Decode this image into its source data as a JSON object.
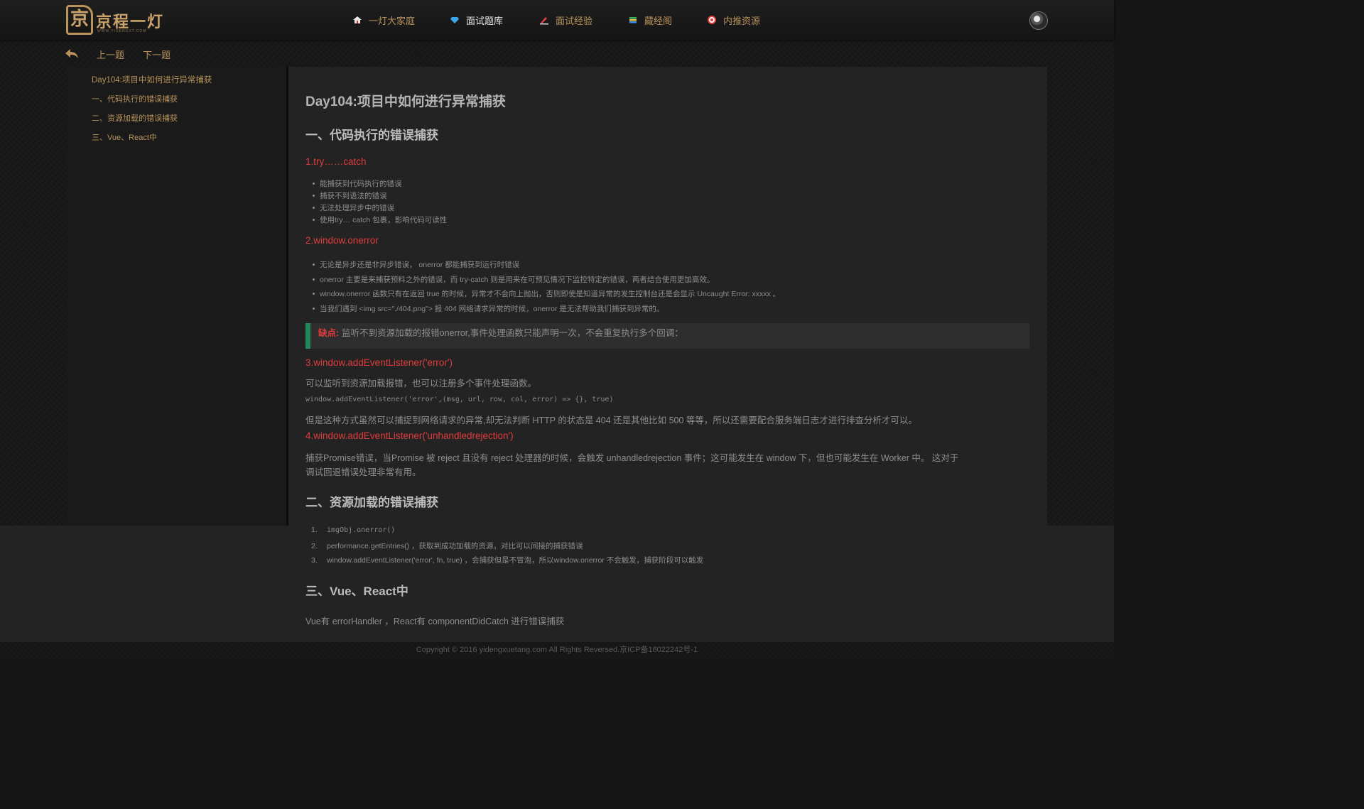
{
  "header": {
    "logo_text": "京程一灯",
    "logo_sub": "WWW.YIDENGXT.COM",
    "nav": [
      {
        "label": "一灯大家庭",
        "icon": "home-icon"
      },
      {
        "label": "面试题库",
        "icon": "diamond-icon",
        "active": true
      },
      {
        "label": "面试经验",
        "icon": "pen-icon"
      },
      {
        "label": "藏经阁",
        "icon": "books-icon"
      },
      {
        "label": "内推资源",
        "icon": "target-icon"
      }
    ]
  },
  "subnav": {
    "prev": "上一题",
    "next": "下一题"
  },
  "toc": [
    "Day104:项目中如何进行异常捕获",
    "一、代码执行的错误捕获",
    "二、资源加载的错误捕获",
    "三、Vue、React中"
  ],
  "article": {
    "title": "Day104:项目中如何进行异常捕获",
    "s1": "一、代码执行的错误捕获",
    "s1_1": "1.try……catch",
    "s1_1_items": [
      "能捕获到代码执行的错误",
      "捕获不到语法的错误",
      "无法处理异步中的错误",
      "使用try… catch 包裹，影响代码可读性"
    ],
    "s1_2": "2.window.onerror",
    "s1_2_items": [
      "无论是异步还是非异步错误， onerror 都能捕获到运行时错误",
      " onerror 主要是来捕获预料之外的错误，而 try-catch 则是用来在可预见情况下监控特定的错误，两者结合使用更加高效。",
      " window.onerror 函数只有在返回 true 的时候，异常才不会向上抛出，否则即使是知道异常的发生控制台还是会显示 Uncaught Error: xxxxx 。",
      "当我们遇到 <img src=\"./404.png\"> 报 404 网络请求异常的时候，onerror 是无法帮助我们捕获到异常的。"
    ],
    "warn_label": "缺点:",
    "warn_text": "监听不到资源加载的报错onerror,事件处理函数只能声明一次，不会重复执行多个回调：",
    "s1_3": "3.window.addEventListener('error')",
    "s1_3_p": "可以监听到资源加载报错，也可以注册多个事件处理函数。",
    "s1_3_code": " window.addEventListener('error',(msg, url, row, col, error) => {}, true)",
    "s1_3_p2": "但是这种方式虽然可以捕捉到网络请求的异常,却无法判断 HTTP 的状态是 404 还是其他比如 500 等等，所以还需要配合服务端日志才进行排查分析才可以。",
    "s1_4": "4.window.addEventListener('unhandledrejection')",
    "s1_4_p1": "捕获Promise错误，当Promise 被 reject 且没有 reject 处理器的时候，会触发 unhandledrejection 事件；这可能发生在 window 下，但也可能发生在 Worker 中。 这对于",
    "s1_4_p2": "调试回退错误处理非常有用。",
    "s2": "二、资源加载的错误捕获",
    "s2_items": [
      "imgObj.onerror()",
      "performance.getEntries() ，获取到成功加载的资源，对比可以间接的捕获错误",
      "window.addEventListener('error', fn, true) ，会捕获但是不冒泡，所以window.onerror 不会触发，捕获阶段可以触发"
    ],
    "s3": "三、Vue、React中",
    "s3_p": "Vue有 errorHandler ，React有 componentDidCatch 进行错误捕获"
  },
  "footer": "Copyright © 2016 yidengxuetang.com All Rights Reversed.京ICP备16022242号-1",
  "colors": {
    "accent": "#b8935a",
    "heading_red": "#e03c3c",
    "warn_border": "#1e8a5a"
  }
}
